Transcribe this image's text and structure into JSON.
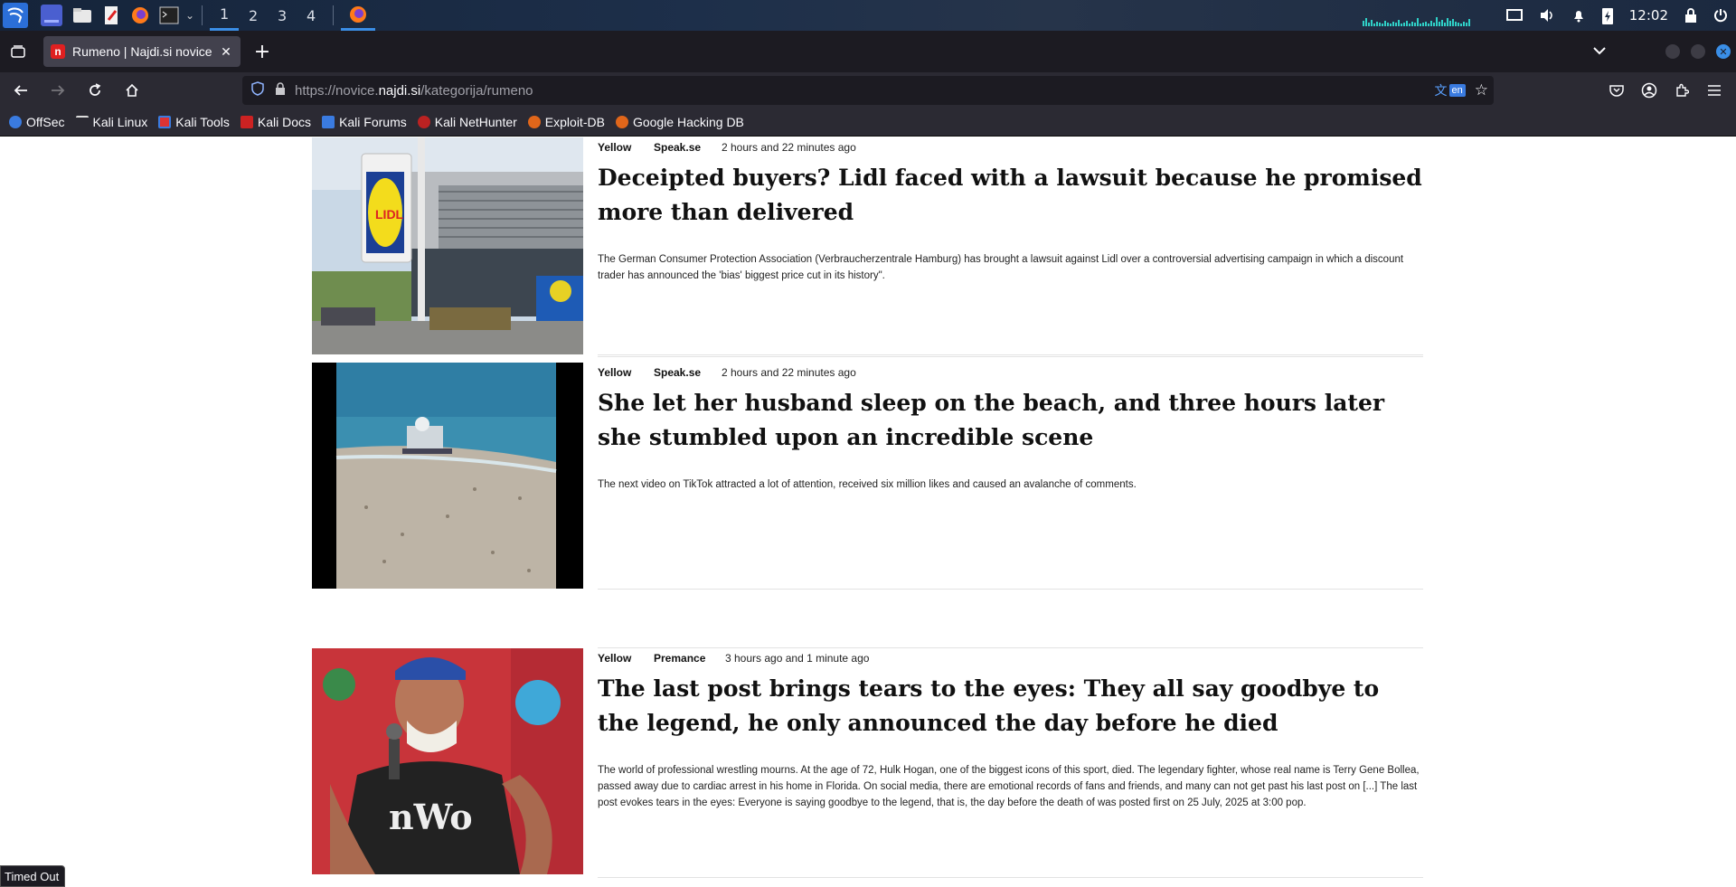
{
  "desktop_panel": {
    "workspaces": [
      "1",
      "2",
      "3",
      "4"
    ],
    "clock": "12:02"
  },
  "browser": {
    "tab": {
      "title": "Rumeno | Najdi.si novice",
      "favicon_letter": "n"
    },
    "url": {
      "prefix": "https://novice.",
      "domain": "najdi.si",
      "path": "/kategorija/rumeno"
    },
    "translate_lang": "en",
    "bookmarks": [
      "OffSec",
      "Kali Linux",
      "Kali Tools",
      "Kali Docs",
      "Kali Forums",
      "Kali NetHunter",
      "Exploit-DB",
      "Google Hacking DB"
    ]
  },
  "articles": [
    {
      "category": "Yellow",
      "source": "Speak.se",
      "time": "2 hours and 22 minutes ago",
      "headline": "Deceipted buyers? Lidl faced with a lawsuit because he promised more than delivered",
      "summary": "The German Consumer Protection Association (Verbraucherzentrale Hamburg) has brought a lawsuit against Lidl over a controversial advertising campaign in which a discount trader has announced the 'bias' biggest price cut in its history\".",
      "image": "lidl-store-photo"
    },
    {
      "category": "Yellow",
      "source": "Speak.se",
      "time": "2 hours and 22 minutes ago",
      "headline": "She let her husband sleep on the beach, and three hours later she stumbled upon an incredible scene",
      "summary": "The next video on TikTok attracted a lot of attention, received six million likes and caused an avalanche of comments.",
      "image": "beach-photo"
    },
    {
      "category": "Yellow",
      "source": "Premance",
      "time": "3 hours ago and 1 minute ago",
      "headline": "The last post brings tears to the eyes: They all say goodbye to the legend, he only announced the day before he died",
      "summary": "The world of professional wrestling mourns. At the age of 72, Hulk Hogan, one of the biggest icons of this sport, died. The legendary fighter, whose real name is Terry Gene Bollea, passed away due to cardiac arrest in his home in Florida. On social media, there are emotional records of fans and friends, and many can not get past his last post on [...] The last post evokes tears in the eyes: Everyone is saying goodbye to the legend, that is, the day before the death of was posted first on 25 July, 2025 at 3:00 pop.",
      "image": "wrestler-photo"
    }
  ],
  "status": "Timed Out"
}
